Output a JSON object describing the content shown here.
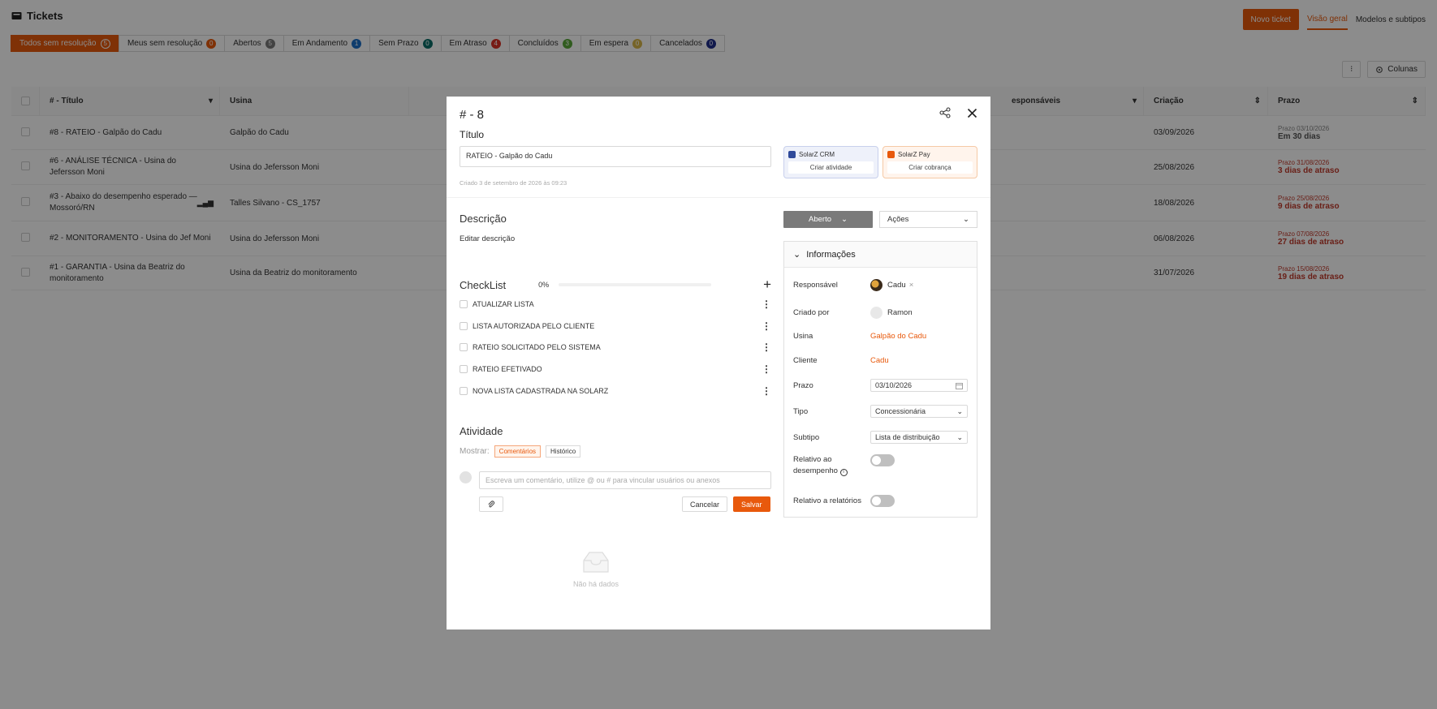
{
  "page": {
    "title": "Tickets",
    "new_ticket_label": "Novo ticket",
    "view_tabs": [
      "Visão geral",
      "Modelos e subtipos"
    ],
    "columns_label": "Colunas",
    "more_label": "⁝"
  },
  "status_tabs": [
    {
      "label": "Todos sem resolução",
      "count": "5",
      "color": "#e8590c",
      "active": true
    },
    {
      "label": "Meus sem resolução",
      "count": "0",
      "color": "#e8590c",
      "active": false
    },
    {
      "label": "Abertos",
      "count": "5",
      "color": "#7a7a7a",
      "active": false
    },
    {
      "label": "Em Andamento",
      "count": "1",
      "color": "#1c6fc6",
      "active": false
    },
    {
      "label": "Sem Prazo",
      "count": "0",
      "color": "#0b6e68",
      "active": false
    },
    {
      "label": "Em Atraso",
      "count": "4",
      "color": "#d93025",
      "active": false
    },
    {
      "label": "Concluídos",
      "count": "3",
      "color": "#59a83a",
      "active": false
    },
    {
      "label": "Em espera",
      "count": "0",
      "color": "#d8b64a",
      "active": false
    },
    {
      "label": "Cancelados",
      "count": "0",
      "color": "#1f2f8a",
      "active": false
    }
  ],
  "table": {
    "headers": {
      "titulo": "# - Título",
      "usina": "Usina",
      "responsaveis": "esponsáveis",
      "criacao": "Criação",
      "prazo": "Prazo"
    },
    "rows": [
      {
        "titulo": "#8 - RATEIO - Galpão do Cadu",
        "usina": "Galpão do Cadu",
        "criacao": "03/09/2026",
        "prazo_sub": "Prazo 03/10/2026",
        "prazo_main": "Em 30 dias",
        "late": false
      },
      {
        "titulo": "#6 - ANÁLISE TÉCNICA - Usina do Jefersson Moni",
        "usina": "Usina do Jefersson Moni",
        "criacao": "25/08/2026",
        "prazo_sub": "Prazo 31/08/2026",
        "prazo_main": "3 dias de atraso",
        "late": true
      },
      {
        "titulo": "#3 - Abaixo do desempenho esperado —",
        "titulo2": "Mossoró/RN",
        "usina": "Talles Silvano - CS_1757",
        "criacao": "18/08/2026",
        "prazo_sub": "Prazo 25/08/2026",
        "prazo_main": "9 dias de atraso",
        "late": true
      },
      {
        "titulo": "#2 - MONITORAMENTO - Usina do Jef Moni",
        "usina": "Usina do Jefersson Moni",
        "criacao": "06/08/2026",
        "prazo_sub": "Prazo 07/08/2026",
        "prazo_main": "27 dias de atraso",
        "late": true
      },
      {
        "titulo": "#1 - GARANTIA - Usina da Beatriz do monitoramento",
        "usina": "Usina da Beatriz do monitoramento",
        "criacao": "31/07/2026",
        "prazo_sub": "Prazo 15/08/2026",
        "prazo_main": "19 dias de atraso",
        "late": true
      }
    ]
  },
  "modal": {
    "title": "# - 8",
    "titulo_label": "Título",
    "titulo_value": "RATEIO - Galpão do Cadu",
    "created": "Criado 3 de setembro de 2026 às 09:23",
    "crm": {
      "name": "SolarZ CRM",
      "action": "Criar atividade",
      "color": "#2f4a9a"
    },
    "pay": {
      "name": "SolarZ Pay",
      "action": "Criar cobrança",
      "color": "#e8590c"
    },
    "descricao_label": "Descrição",
    "descricao_edit": "Editar descrição",
    "checklist_label": "CheckList",
    "checklist_progress": 0,
    "checklist_progress_label": "0%",
    "checklist_items": [
      "ATUALIZAR LISTA",
      "LISTA AUTORIZADA PELO CLIENTE",
      "RATEIO SOLICITADO PELO SISTEMA",
      "RATEIO EFETIVADO",
      "NOVA LISTA CADASTRADA NA SOLARZ"
    ],
    "atividade_label": "Atividade",
    "mostrar_label": "Mostrar:",
    "chip_comentarios": "Comentários",
    "chip_historico": "Histórico",
    "comment_placeholder": "Escreva um comentário, utilize @ ou # para vincular usuários ou anexos",
    "cancel_label": "Cancelar",
    "save_label": "Salvar",
    "empty_label": "Não há dados",
    "status_value": "Aberto",
    "acoes_label": "Ações",
    "info": {
      "header": "Informações",
      "responsavel_label": "Responsável",
      "responsavel_value": "Cadu",
      "criado_por_label": "Criado por",
      "criado_por_value": "Ramon",
      "usina_label": "Usina",
      "usina_value": "Galpão do Cadu",
      "cliente_label": "Cliente",
      "cliente_value": "Cadu",
      "prazo_label": "Prazo",
      "prazo_value": "03/10/2026",
      "tipo_label": "Tipo",
      "tipo_value": "Concessionária",
      "subtipo_label": "Subtipo",
      "subtipo_value": "Lista de distribuição",
      "relativo_desempenho_label_1": "Relativo ao",
      "relativo_desempenho_label_2": "desempenho",
      "relativo_desempenho_on": false,
      "relativo_relatorios_label": "Relativo a relatórios",
      "relativo_relatorios_on": false
    }
  },
  "colors": {
    "accent": "#e8590c",
    "late": "#c0392b",
    "arrow": "#e3201b"
  }
}
